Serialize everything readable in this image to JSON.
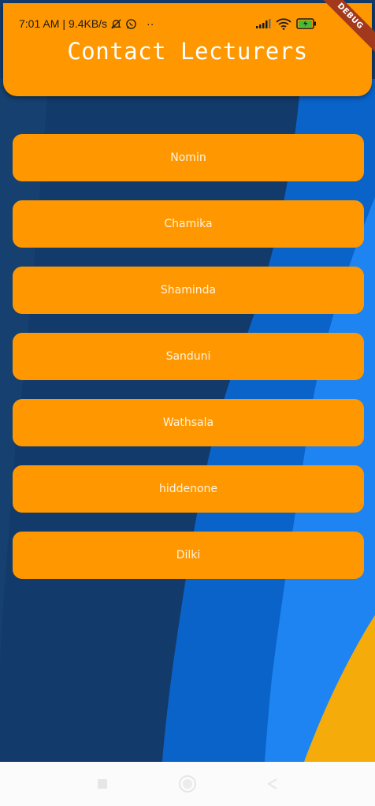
{
  "status_bar": {
    "time": "7:01 AM",
    "separator": "|",
    "speed": "9.4KB/s",
    "more": "··",
    "icons": [
      "mute-icon",
      "whatsapp-icon",
      "signal-icon",
      "wifi-icon",
      "battery-icon"
    ]
  },
  "header": {
    "title": "Contact Lecturers"
  },
  "debug_banner": "DEBUG",
  "lecturers": [
    "Nomin",
    "Chamika",
    "Shaminda",
    "Sanduni",
    "Wathsala",
    "hiddenone",
    "Dilki"
  ],
  "nav_bar": {
    "icons": [
      "recents-icon",
      "home-icon",
      "back-icon"
    ]
  },
  "colors": {
    "accent": "#ff9800",
    "background_dark": "#123a6b",
    "background_mid": "#0a63c9",
    "background_light": "#1e84f2",
    "background_yellow": "#f5ac0b",
    "debug": "#a3391c"
  }
}
